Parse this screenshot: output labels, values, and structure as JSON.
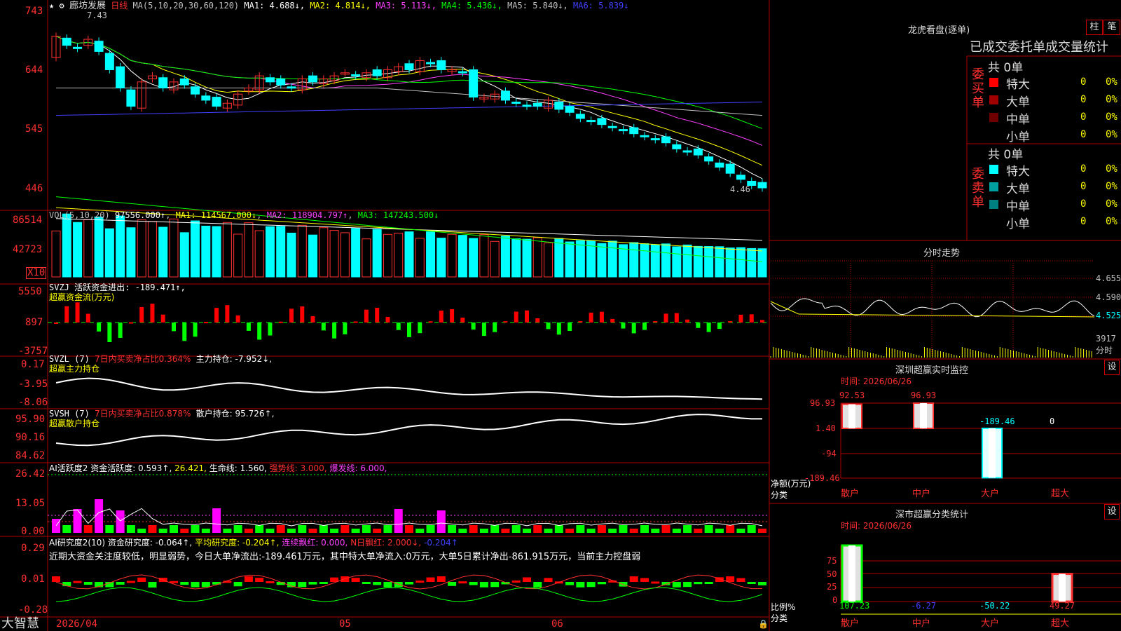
{
  "stock": {
    "star": "★",
    "name": "廊坊发展",
    "period": "日线",
    "ma_head": "MA(5,10,20,30,60,120)",
    "ma": [
      {
        "t": "MA1: 4.688↓",
        "c": "#ffffff"
      },
      {
        "t": "MA2: 4.814↓",
        "c": "#ffff00"
      },
      {
        "t": "MA3: 5.113↓",
        "c": "#ff40ff"
      },
      {
        "t": "MA4: 5.436↓",
        "c": "#00ff00"
      },
      {
        "t": "MA5: 5.840↓",
        "c": "#c0c0c0"
      },
      {
        "t": "MA6: 5.839↓",
        "c": "#4040ff"
      }
    ],
    "high_label": "7.43",
    "low_label": "4.46"
  },
  "price_axis": [
    "743",
    "644",
    "545",
    "446"
  ],
  "vol": {
    "head": "VOL(5,10,20)",
    "v": "97556.000↑",
    "ma1": "MA1: 114567.000↓",
    "ma2": "MA2: 118904.797↑",
    "ma3": "MA3: 147243.500↓",
    "axis": [
      "86514",
      "42723"
    ],
    "unit": "X10"
  },
  "svzj": {
    "head": "SVZJ  活跃资金进出: -189.471↑,",
    "sub": "超赢资金流(万元)",
    "axis": [
      "5550",
      "897",
      "-3757"
    ]
  },
  "svzl": {
    "head": "SVZL (7)",
    "hl": "7日内买卖净占比0.364%",
    "rest": "主力持仓: -7.952↓,",
    "sub": "超赢主力持仓",
    "axis": [
      "0.17",
      "-3.95",
      "-8.06"
    ]
  },
  "svsh": {
    "head": "SVSH (7)",
    "hl": "7日内买卖净占比0.878%",
    "rest": "散户持仓: 95.726↑,",
    "sub": "超赢散户持仓",
    "axis": [
      "95.90",
      "90.16",
      "84.62"
    ]
  },
  "ai1": {
    "head": "AI活跃度2 资金活跃度: 0.593↑,",
    "v2": "26.421,",
    "v3": "生命线: 1.560,",
    "v4": "强势线: 3.000,",
    "v5": "爆发线: 6.000,",
    "axis": [
      "26.42",
      "13.05",
      "0.00"
    ]
  },
  "ai2": {
    "head": "AI研究度2(10) 资金研究度: -0.064↑,",
    "v2": "平均研究度: -0.204↑,",
    "v3": "连续飘红: 0.000,",
    "v4": "N日飘红: 2.000↓,",
    "v5": "-0.204↑",
    "note": "近期大资金关注度较低，明显弱势，今日大单净流出:-189.461万元，其中特大单净流入:0万元，大单5日累计净出-861.915万元，当前主力控盘弱",
    "axis": [
      "0.29",
      "0.01",
      "-0.28"
    ]
  },
  "dates": [
    "2026/04",
    "05",
    "06"
  ],
  "brand": "大智慧",
  "lhb": {
    "title": "龙虎看盘(逐单)",
    "btn1": "柱",
    "btn2": "笔",
    "tabs": "已成交委托单成交量统计",
    "buy": {
      "vlabel": "委买单",
      "total": "共 0单",
      "rows": [
        {
          "n": "特大",
          "v": "0",
          "p": "0%",
          "c": "#ff0000"
        },
        {
          "n": "大单",
          "v": "0",
          "p": "0%",
          "c": "#a00000"
        },
        {
          "n": "中单",
          "v": "0",
          "p": "0%",
          "c": "#700000"
        },
        {
          "n": "小单",
          "v": "0",
          "p": "0%",
          "c": "#000000"
        }
      ]
    },
    "sell": {
      "vlabel": "委卖单",
      "total": "共 0单",
      "rows": [
        {
          "n": "特大",
          "v": "0",
          "p": "0%",
          "c": "#00ffff"
        },
        {
          "n": "大单",
          "v": "0",
          "p": "0%",
          "c": "#00a0a0"
        },
        {
          "n": "中单",
          "v": "0",
          "p": "0%",
          "c": "#008080"
        },
        {
          "n": "小单",
          "v": "0",
          "p": "0%",
          "c": "#000000"
        }
      ]
    }
  },
  "fenshi": {
    "title": "分时走势",
    "axis": [
      "4.655",
      "4.590",
      "4.525"
    ],
    "vol": "3917",
    "vol_unit": "分时"
  },
  "monitor": {
    "title": "深圳超赢实时监控",
    "btn": "设",
    "time": "时间: 2026/06/26",
    "axis": [
      "96.93",
      "1.40",
      "-94",
      "-189.46"
    ],
    "ylabel": "净额(万元)",
    "xlabel": "分类",
    "cats": [
      "散户",
      "中户",
      "大户",
      "超大"
    ],
    "values": [
      "92.53",
      "96.93",
      "-189.46",
      "0"
    ]
  },
  "classify": {
    "title": "深市超赢分类统计",
    "btn": "设",
    "time": "时间: 2026/06/26",
    "axis": [
      "75",
      "50",
      "25",
      "0"
    ],
    "ylabel": "比例%",
    "xlabel": "分类",
    "cats": [
      "散户",
      "中户",
      "大户",
      "超大"
    ],
    "values": [
      "107.23",
      "-6.27",
      "-50.22",
      "49.27"
    ]
  },
  "chart_data": [
    {
      "type": "candlestick",
      "title": "廊坊发展 日线",
      "ylim": [
        4.4,
        7.45
      ],
      "x": [
        "2026/04",
        "05",
        "06"
      ],
      "close": [
        6.95,
        6.8,
        6.75,
        6.9,
        6.7,
        6.4,
        6.1,
        5.8,
        6.2,
        6.3,
        6.1,
        6.2,
        6.15,
        6.0,
        5.9,
        5.8,
        5.85,
        6.0,
        6.1,
        6.3,
        6.2,
        6.15,
        6.1,
        6.25,
        6.2,
        6.25,
        6.3,
        6.35,
        6.3,
        6.35,
        6.3,
        6.4,
        6.45,
        6.4,
        6.55,
        6.5,
        6.4,
        6.4,
        6.35,
        5.95,
        5.95,
        6.0,
        5.9,
        5.85,
        5.8,
        5.8,
        5.9,
        5.75,
        5.7,
        5.6,
        5.55,
        5.5,
        5.45,
        5.4,
        5.35,
        5.3,
        5.25,
        5.2,
        5.1,
        5.05,
        5.0,
        4.9,
        4.8,
        4.7,
        4.6,
        4.5,
        4.46
      ],
      "ma_series": [
        "MA1",
        "MA2",
        "MA3",
        "MA4",
        "MA5",
        "MA6"
      ]
    },
    {
      "type": "bar",
      "title": "VOL(5,10,20)",
      "ylim": [
        0,
        86514
      ],
      "unit": "X10",
      "last": 97556
    },
    {
      "type": "line",
      "title": "分时走势",
      "ylim": [
        4.46,
        4.655
      ]
    },
    {
      "type": "bar",
      "title": "深圳超赢实时监控",
      "categories": [
        "散户",
        "中户",
        "大户",
        "超大"
      ],
      "values": [
        92.53,
        96.93,
        -189.46,
        0
      ],
      "ylabel": "净额(万元)",
      "ylim": [
        -189.46,
        96.93
      ]
    },
    {
      "type": "bar",
      "title": "深市超赢分类统计",
      "categories": [
        "散户",
        "中户",
        "大户",
        "超大"
      ],
      "values": [
        107.23,
        -6.27,
        -50.22,
        49.27
      ],
      "ylabel": "比例%",
      "ylim": [
        0,
        100
      ]
    }
  ]
}
